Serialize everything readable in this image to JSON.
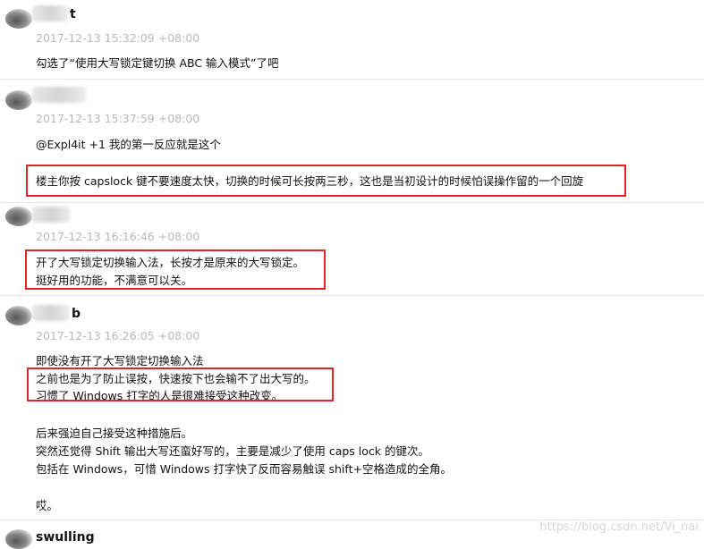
{
  "comments": [
    {
      "username": "t",
      "time": "2017-12-13 15:32:09 +08:00",
      "lines": [
        "勾选了“使用大写锁定键切换 ABC 输入模式”了吧"
      ]
    },
    {
      "username": "",
      "time": "2017-12-13 15:37:59 +08:00",
      "lines": [
        "@Expl4it +1 我的第一反应就是这个",
        "楼主你按 capslock 键不要速度太快，切换的时候可长按两三秒，这也是当初设计的时候怕误操作留的一个回旋"
      ]
    },
    {
      "username": "",
      "time": "2017-12-13 16:16:46 +08:00",
      "lines": [
        "开了大写锁定切换输入法，长按才是原来的大写锁定。",
        "挺好用的功能，不满意可以关。"
      ]
    },
    {
      "username": "b",
      "time": "2017-12-13 16:26:05 +08:00",
      "lines": [
        "即使没有开了大写锁定切换输入法",
        "之前也是为了防止误按，快速按下也会输不了出大写的。",
        "习惯了 Windows 打字的人是很难接受这种改变。",
        "后来强迫自己接受这种措施后。",
        "突然还觉得 Shift 输出大写还蛮好写的，主要是减少了使用 caps lock 的键次。",
        "包括在 Windows，可惜 Windows 打字快了反而容易触误 shift+空格造成的全角。",
        "哎。"
      ]
    },
    {
      "username": "swulling",
      "time": "",
      "lines": []
    }
  ],
  "watermark": "https://blog.csdn.net/Vi_nai"
}
